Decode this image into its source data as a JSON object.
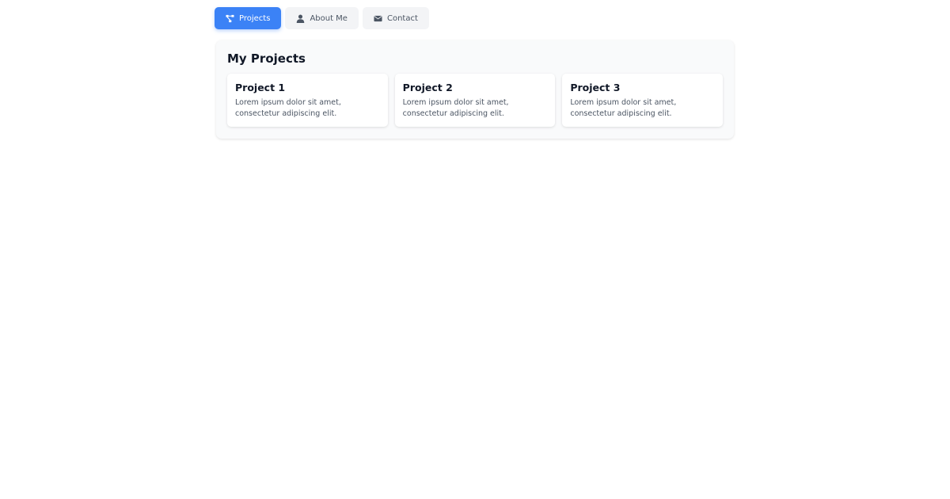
{
  "nav": {
    "tabs": [
      {
        "label": "Projects",
        "icon": "project-diagram-icon",
        "active": true
      },
      {
        "label": "About Me",
        "icon": "user-icon",
        "active": false
      },
      {
        "label": "Contact",
        "icon": "envelope-icon",
        "active": false
      }
    ]
  },
  "projects": {
    "title": "My Projects",
    "items": [
      {
        "title": "Project 1",
        "description": "Lorem ipsum dolor sit amet, consectetur adipiscing elit."
      },
      {
        "title": "Project 2",
        "description": "Lorem ipsum dolor sit amet, consectetur adipiscing elit."
      },
      {
        "title": "Project 3",
        "description": "Lorem ipsum dolor sit amet, consectetur adipiscing elit."
      }
    ]
  },
  "colors": {
    "accent": "#3b82f6",
    "tab_inactive_bg": "#f3f4f6",
    "panel_bg": "#f9fafb"
  }
}
